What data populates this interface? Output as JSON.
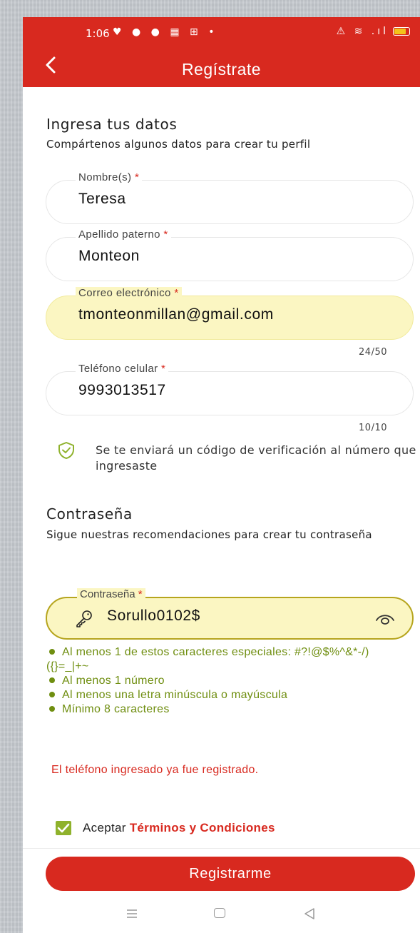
{
  "status_bar": {
    "time": "1:06",
    "left_icons": "♥ ● ● ▦ ⊞ •",
    "right_icons": "⚠ ≋ .ıl"
  },
  "header": {
    "title": "Regístrate"
  },
  "personal": {
    "heading": "Ingresa tus datos",
    "subtitle": "Compártenos algunos datos para crear tu perfil",
    "fields": [
      {
        "label": "Nombre(s)",
        "value": "Teresa"
      },
      {
        "label": "Apellido paterno",
        "value": "Monteon"
      },
      {
        "label": "Correo electrónico",
        "value": "tmonteonmillan@gmail.com",
        "counter": "24/50"
      },
      {
        "label": "Teléfono celular",
        "value": "9993013517",
        "counter": "10/10"
      }
    ],
    "required_mark": "*",
    "verify_notice": "Se te enviará un código de verificación al número que ingresaste"
  },
  "password": {
    "heading": "Contraseña",
    "subtitle": "Sigue nuestras recomendaciones para crear tu contraseña",
    "label": "Contraseña",
    "value": "Sorullo0102$",
    "rules": [
      "Al menos 1 de estos caracteres especiales: #?!@$%^&*-/)({}=_|+~",
      "Al menos 1 número",
      "Al menos una letra minúscula o mayúscula",
      "Mínimo 8 caracteres"
    ]
  },
  "error_message": "El teléfono ingresado ya fue registrado.",
  "terms": {
    "prefix": "Aceptar",
    "link": "Términos y Condiciones",
    "checked": true
  },
  "submit_label": "Registrarme",
  "colors": {
    "primary": "#d8291f",
    "highlight": "#fbf6c2",
    "rule_green": "#6f8e10",
    "check_green": "#8fb22c"
  }
}
